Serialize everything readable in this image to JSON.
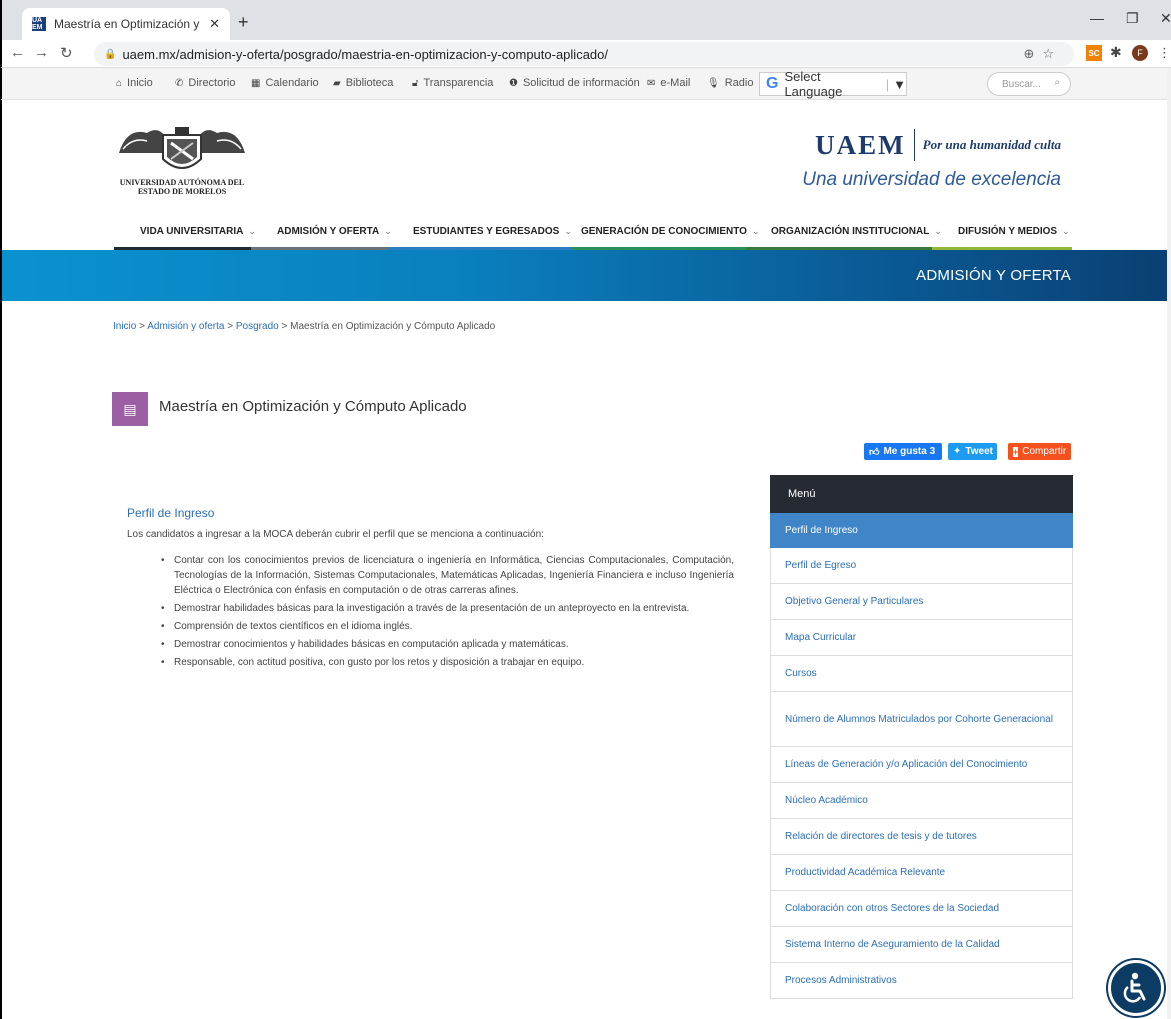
{
  "browser": {
    "tab_title": "Maestría en Optimización y Cóm",
    "favicon_text": "UA EM",
    "url": "uaem.mx/admision-y-oferta/posgrado/maestria-en-optimizacion-y-computo-aplicado/",
    "ext_badge": "SC",
    "profile_initial": "F"
  },
  "utility_bar": {
    "items": [
      {
        "icon": "home-icon",
        "label": "Inicio"
      },
      {
        "icon": "phone-icon",
        "label": "Directorio"
      },
      {
        "icon": "calendar-icon",
        "label": "Calendario"
      },
      {
        "icon": "book-icon",
        "label": "Biblioteca"
      },
      {
        "icon": "unlock-icon",
        "label": "Transparencia"
      },
      {
        "icon": "info-icon",
        "label": "Solicitud de información"
      },
      {
        "icon": "mail-icon",
        "label": "e-Mail"
      },
      {
        "icon": "microphone-icon",
        "label": "Radio"
      }
    ],
    "language_label": "Select Language",
    "search_placeholder": "Buscar..."
  },
  "header": {
    "university_line1": "Universidad Autónoma del",
    "university_line2": "Estado de Morelos",
    "brand": "UAEM",
    "motto": "Por una humanidad culta",
    "tagline": "Una universidad de excelencia"
  },
  "main_nav": [
    {
      "label": "VIDA UNIVERSITARIA",
      "color": "#1f2a33"
    },
    {
      "label": "ADMISIÓN Y OFERTA",
      "color": "#6b7179"
    },
    {
      "label": "ESTUDIANTES Y EGRESADOS",
      "color": "#2b7ec1"
    },
    {
      "label": "GENERACIÓN DE CONOCIMIENTO",
      "color": "#2b8f5a"
    },
    {
      "label": "ORGANIZACIÓN INSTITUCIONAL",
      "color": "#3b7a3f"
    },
    {
      "label": "DIFUSIÓN Y MEDIOS",
      "color": "#8fb83a"
    }
  ],
  "banner": {
    "title": "ADMISIÓN Y OFERTA"
  },
  "breadcrumb": {
    "inicio": "Inicio",
    "admision": "Admisión y oferta",
    "posgrado": "Posgrado",
    "current": "Maestría en Optimización y Cómputo Aplicado",
    "separator": ">"
  },
  "page": {
    "title": "Maestría en Optimización y Cómputo Aplicado",
    "section_title": "Perfil de Ingreso",
    "intro": "Los candidatos a ingresar a la MOCA deberán cubrir el perfil que se menciona a continuación:",
    "requirements": [
      "Contar con los conocimientos previos de licenciatura o ingeniería en Informática, Ciencias Computacionales, Computación, Tecnologías de la Información, Sistemas Computacionales, Matemáticas Aplicadas, Ingeniería Financiera e incluso Ingeniería Eléctrica o Electrónica con énfasis en computación o de otras carreras afines.",
      "Demostrar habilidades básicas para la investigación a través de la presentación de un anteproyecto en la entrevista.",
      "Comprensión de textos científicos en el idioma inglés.",
      "Demostrar conocimientos y habilidades básicas en computación aplicada y matemáticas.",
      "Responsable, con actitud positiva, con gusto por los retos y disposición a trabajar en equipo."
    ]
  },
  "share": {
    "like_label": "Me gusta 3",
    "tweet_label": "Tweet",
    "share_label": "Compartir"
  },
  "side_menu": {
    "header": "Menú",
    "items": [
      "Perfil de Ingreso",
      "Perfil de Egreso",
      "Objetivo General y Particulares",
      "Mapa Curricular",
      "Cursos",
      "Número de Alumnos Matriculados por Cohorte Generacional",
      "Líneas de Generación y/o Aplicación del Conocimiento",
      "Núcleo Académico",
      "Relación de directores de tesis y de tutores",
      "Productividad Académica Relevante",
      "Colaboración con otros Sectores de la Sociedad",
      "Sistema Interno de Aseguramiento de la Calidad",
      "Procesos Administrativos"
    ]
  }
}
